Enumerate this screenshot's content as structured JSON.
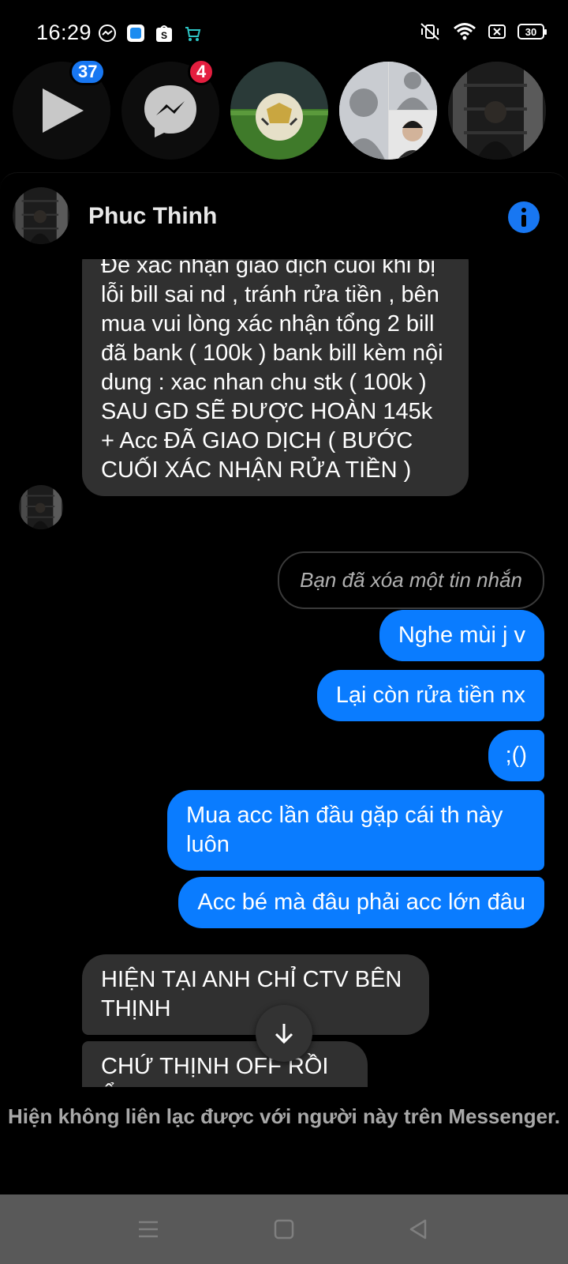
{
  "status_bar": {
    "time": "16:29",
    "battery": "30"
  },
  "chat_heads": {
    "video_badge": "37",
    "messenger_badge": "4"
  },
  "header": {
    "contact_name": "Phuc Thinh"
  },
  "messages": [
    {
      "direction": "in",
      "text": "Để xác nhận giao dịch cuối khi bị lỗi bill sai nd , tránh rửa tiền , bên mua vui lòng xác nhận tổng 2 bill đã bank ( 100k ) bank bill kèm nội dung : xac nhan chu stk ( 100k ) SAU GD SẼ ĐƯỢC HOÀN 145k + Acc ĐÃ GIAO DỊCH ( BƯỚC CUỐI XÁC NHẬN RỬA TIỀN )"
    },
    {
      "direction": "out",
      "deleted": true,
      "text": "Bạn đã xóa một tin nhắn"
    },
    {
      "direction": "out",
      "text": "Nghe mùi j v"
    },
    {
      "direction": "out",
      "text": "Lại còn rửa tiền nx"
    },
    {
      "direction": "out",
      "text": ";()"
    },
    {
      "direction": "out",
      "text": "Mua acc lần đầu gặp cái th này luôn"
    },
    {
      "direction": "out",
      "text": "Acc bé mà đâu phải acc lớn đâu"
    },
    {
      "direction": "in",
      "text": "HIỆN TẠI ANH CHỈ CTV BÊN THỊNH"
    },
    {
      "direction": "in",
      "text": "CHỨ THỊNH OFF RỒI Ể"
    }
  ],
  "footer": {
    "notice": "Hiện không liên lạc được với người này trên Messenger."
  },
  "colors": {
    "outgoing_bubble": "#0a7cff",
    "incoming_bubble": "#303030",
    "badge_blue": "#1877f2",
    "badge_red": "#e41e3f"
  }
}
